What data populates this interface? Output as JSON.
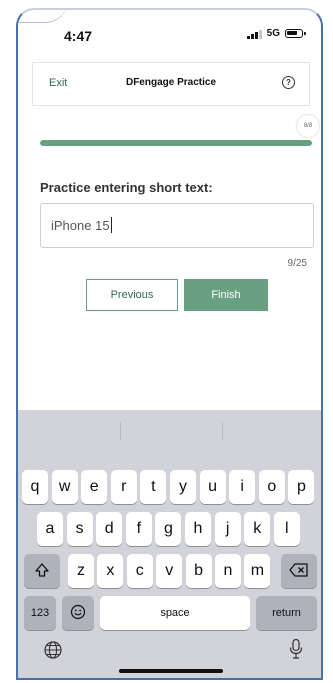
{
  "status": {
    "time": "4:47",
    "network": "5G"
  },
  "header": {
    "exit_label": "Exit",
    "title": "DFengage Practice",
    "help_symbol": "?"
  },
  "progress": {
    "label": "8/8",
    "fraction": 1.0
  },
  "question": {
    "prompt": "Practice entering short text:",
    "value": "iPhone 15",
    "char_count": "9/25"
  },
  "buttons": {
    "previous": "Previous",
    "finish": "Finish"
  },
  "keyboard": {
    "row1": [
      "q",
      "w",
      "e",
      "r",
      "t",
      "y",
      "u",
      "i",
      "o",
      "p"
    ],
    "row2": [
      "a",
      "s",
      "d",
      "f",
      "g",
      "h",
      "j",
      "k",
      "l"
    ],
    "row3": [
      "z",
      "x",
      "c",
      "v",
      "b",
      "n",
      "m"
    ],
    "numbers_label": "123",
    "space_label": "space",
    "return_label": "return",
    "icons": [
      "shift-icon",
      "backspace-icon",
      "emoji-icon",
      "globe-icon",
      "microphone-icon"
    ]
  },
  "colors": {
    "accent": "#6aa082",
    "link": "#2e6b4f",
    "keyboard_bg": "#d1d3d9"
  }
}
